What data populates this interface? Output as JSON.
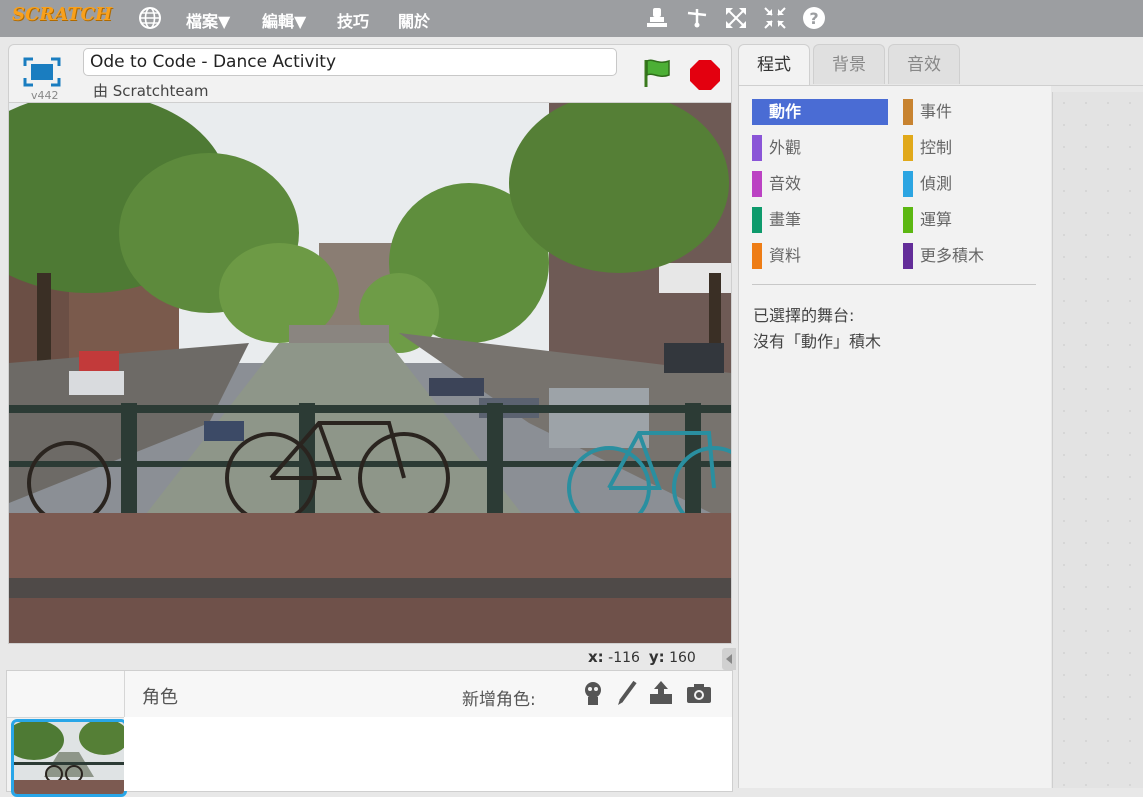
{
  "app": {
    "logo_text": "SCRATCH",
    "version": "v442"
  },
  "menu": {
    "language_icon": "globe-icon",
    "items": [
      "檔案▼",
      "編輯▼",
      "技巧",
      "關於"
    ]
  },
  "toolbar": {
    "icons": [
      "duplicate-stamp-icon",
      "delete-scissors-icon",
      "grow-icon",
      "shrink-icon",
      "help-icon"
    ]
  },
  "project": {
    "title": "Ode to Code - Dance Activity",
    "author_line": "由 Scratchteam"
  },
  "stage": {
    "coords": {
      "x_label": "x:",
      "x_value": "-116",
      "y_label": "y:",
      "y_value": "160"
    }
  },
  "sprites": {
    "header_label": "角色",
    "new_sprite_label": "新增角色:",
    "tools": [
      "sprite-library-icon",
      "paint-brush-icon",
      "upload-icon",
      "camera-icon"
    ]
  },
  "tabs": [
    {
      "label": "程式",
      "active": true
    },
    {
      "label": "背景",
      "active": false
    },
    {
      "label": "音效",
      "active": false
    }
  ],
  "categories": [
    {
      "label": "動作",
      "color": "#4a6cd4",
      "active": true
    },
    {
      "label": "事件",
      "color": "#c88330",
      "active": false
    },
    {
      "label": "外觀",
      "color": "#8a55d7",
      "active": false
    },
    {
      "label": "控制",
      "color": "#e1a91a",
      "active": false
    },
    {
      "label": "音效",
      "color": "#bb42c3",
      "active": false
    },
    {
      "label": "偵測",
      "color": "#2ca5e2",
      "active": false
    },
    {
      "label": "畫筆",
      "color": "#0e9a6c",
      "active": false
    },
    {
      "label": "運算",
      "color": "#5cb712",
      "active": false
    },
    {
      "label": "資料",
      "color": "#ee7d16",
      "active": false
    },
    {
      "label": "更多積木",
      "color": "#632d99",
      "active": false
    }
  ],
  "palette_note": {
    "line1": "已選擇的舞台:",
    "line2": "沒有「動作」積木"
  }
}
